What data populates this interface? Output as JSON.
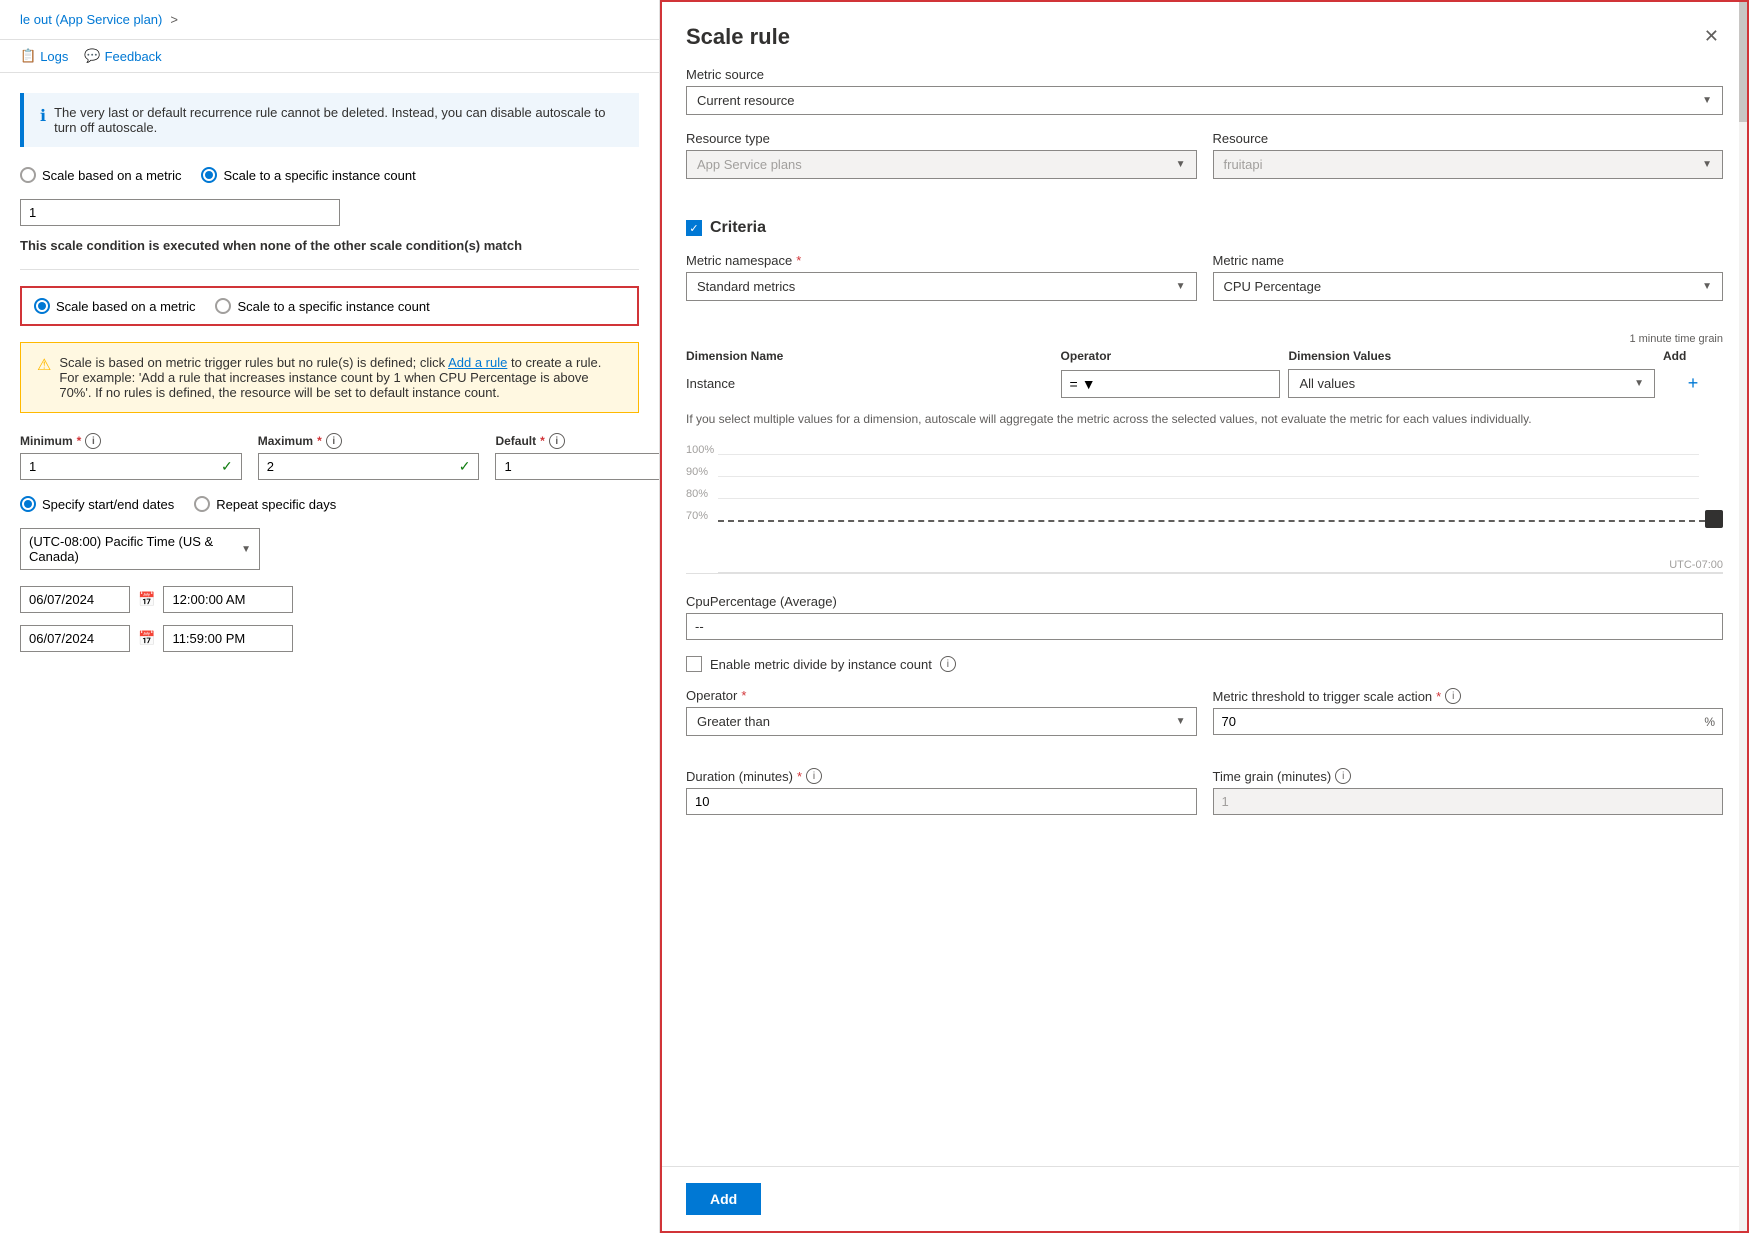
{
  "breadcrumb": {
    "link_text": "le out (App Service plan)",
    "separator": ">"
  },
  "toolbar": {
    "logs_label": "Logs",
    "feedback_label": "Feedback"
  },
  "left_panel": {
    "info_message": "The very last or default recurrence rule cannot be deleted. Instead, you can disable autoscale to turn off autoscale.",
    "scale_options": {
      "option1": "Scale based on a metric",
      "option2": "Scale to a specific instance count"
    },
    "instance_count": "1",
    "scale_condition_note": "This scale condition is executed when none of the other scale condition(s) match",
    "scale_options2": {
      "option1": "Scale based on a metric",
      "option2": "Scale to a specific instance count"
    },
    "warning_message": "Scale is based on metric trigger rules but no rule(s) is defined; click",
    "warning_link": "Add a rule",
    "warning_message2": "to create a rule. For example: 'Add a rule that increases instance count by 1 when CPU Percentage is above 70%'. If no rules is defined, the resource will be set to default instance count.",
    "minimum_label": "Minimum",
    "maximum_label": "Maximum",
    "default_label": "Default",
    "minimum_value": "1",
    "maximum_value": "2",
    "default_value": "1",
    "schedule_options": {
      "option1": "Specify start/end dates",
      "option2": "Repeat specific days"
    },
    "timezone": "(UTC-08:00) Pacific Time (US & Canada)",
    "start_date": "06/07/2024",
    "start_time": "12:00:00 AM",
    "end_date": "06/07/2024",
    "end_time": "11:59:00 PM"
  },
  "scale_rule_dialog": {
    "title": "Scale rule",
    "metric_source_label": "Metric source",
    "metric_source_value": "Current resource",
    "resource_type_label": "Resource type",
    "resource_type_value": "App Service plans",
    "resource_label": "Resource",
    "resource_value": "fruitapi",
    "criteria_title": "Criteria",
    "metric_namespace_label": "Metric namespace",
    "metric_namespace_required": true,
    "metric_namespace_value": "Standard metrics",
    "metric_name_label": "Metric name",
    "metric_name_value": "CPU Percentage",
    "time_grain_note": "1 minute time grain",
    "dimension_name_header": "Dimension Name",
    "operator_header": "Operator",
    "dimension_values_header": "Dimension Values",
    "add_header": "Add",
    "dimension_name": "Instance",
    "dimension_operator": "=",
    "dimension_values": "All values",
    "aggregate_info": "If you select multiple values for a dimension, autoscale will aggregate the metric across the selected values, not evaluate the metric for each values individually.",
    "chart_labels": {
      "y100": "100%",
      "y90": "90%",
      "y80": "80%",
      "y70": "70%",
      "utc": "UTC-07:00"
    },
    "metric_display_label": "CpuPercentage (Average)",
    "metric_display_value": "--",
    "enable_metric_divide_label": "Enable metric divide by instance count",
    "operator_label": "Operator",
    "operator_required": true,
    "operator_value": "Greater than",
    "metric_threshold_label": "Metric threshold to trigger scale action",
    "metric_threshold_required": true,
    "metric_threshold_value": "70",
    "metric_threshold_unit": "%",
    "duration_label": "Duration (minutes)",
    "duration_required": true,
    "duration_value": "10",
    "time_grain_label": "Time grain (minutes)",
    "time_grain_value": "1",
    "add_button_label": "Add"
  }
}
